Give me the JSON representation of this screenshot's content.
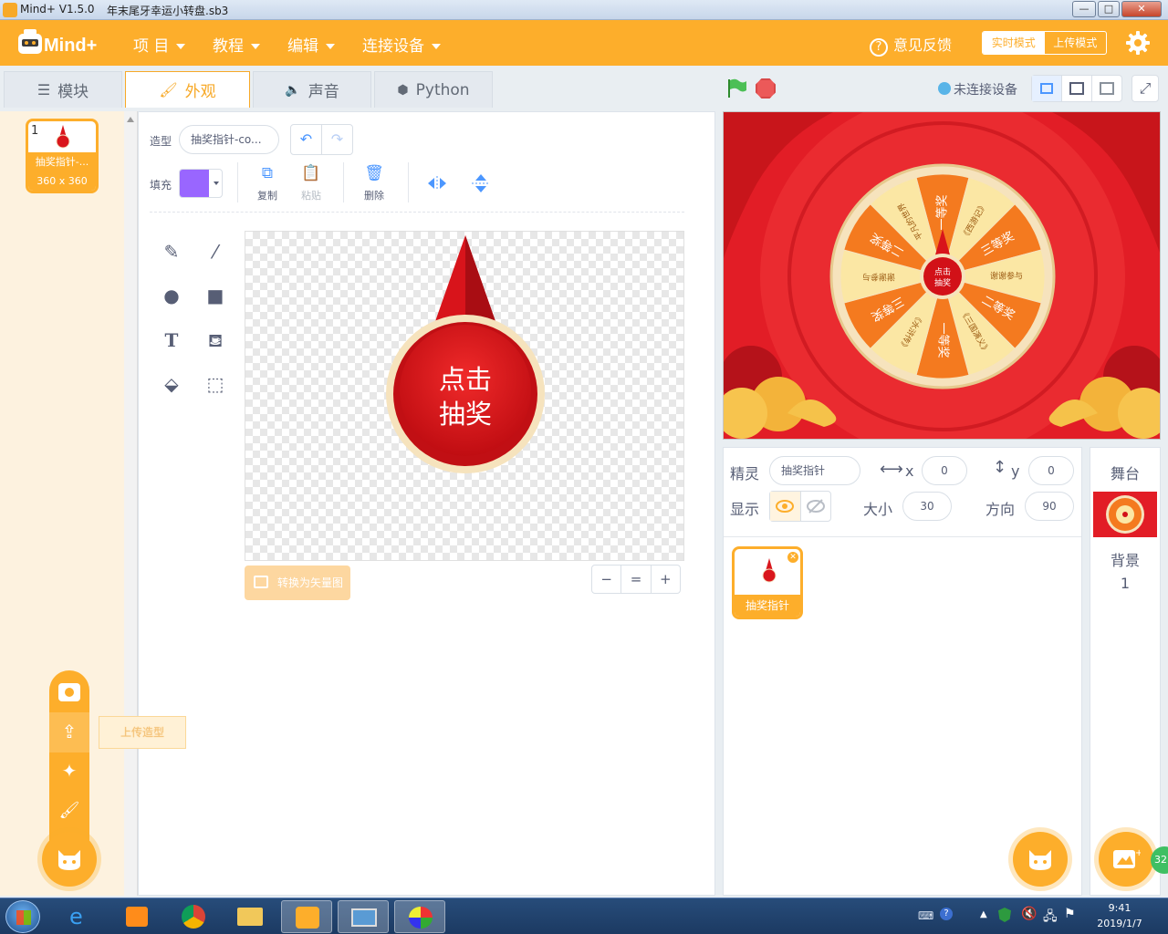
{
  "window": {
    "app_title": "Mind+ V1.5.0",
    "file_name": "年末尾牙幸运小转盘.sb3",
    "min": "—",
    "max": "□",
    "close": "✕"
  },
  "menubar": {
    "brand": "Mind+",
    "items": [
      "项 目",
      "教程",
      "编辑",
      "连接设备"
    ],
    "feedback": "意见反馈",
    "mode_realtime": "实时模式",
    "mode_upload": "上传模式"
  },
  "tabs": [
    {
      "label": "模块",
      "icon": "blocks-icon"
    },
    {
      "label": "外观",
      "icon": "brush-icon"
    },
    {
      "label": "声音",
      "icon": "speaker-icon"
    },
    {
      "label": "Python",
      "icon": "python-icon"
    }
  ],
  "costume_list": {
    "items": [
      {
        "index": "1",
        "name": "抽奖指针-...",
        "size": "360 x 360"
      }
    ]
  },
  "editor": {
    "costume_label": "造型",
    "costume_name": "抽奖指针-co...",
    "fill_label": "填充",
    "fill_color": "#9966ff",
    "copy": "复制",
    "paste": "粘贴",
    "delete": "删除",
    "pointer_text_line1": "点击",
    "pointer_text_line2": "抽奖",
    "convert_vector": "转换为矢量图",
    "zoom_out": "−",
    "zoom_reset": "=",
    "zoom_in": "+"
  },
  "upload_tooltip": "上传造型",
  "stage_header": {
    "device_status": "未连接设备"
  },
  "stage": {
    "center_line1": "点击",
    "center_line2": "抽奖",
    "segments": [
      "一等奖",
      "《西游记》",
      "三等奖",
      "谢谢参与",
      "二等奖",
      "《三国演义》",
      "一等奖",
      "《水浒传》",
      "三等奖",
      "谢谢参与",
      "二等奖",
      "平凡的世界"
    ]
  },
  "sprite_info": {
    "sprite_label": "精灵",
    "sprite_name": "抽奖指针",
    "x_label": "x",
    "x_value": "0",
    "y_label": "y",
    "y_value": "0",
    "show_label": "显示",
    "size_label": "大小",
    "size_value": "30",
    "direction_label": "方向",
    "direction_value": "90"
  },
  "sprites": [
    {
      "name": "抽奖指针"
    }
  ],
  "stage_panel": {
    "title": "舞台",
    "backdrop_label": "背景",
    "backdrop_count": "1"
  },
  "taskbar": {
    "time": "9:41",
    "date": "2019/1/7",
    "badge": "32"
  },
  "colors": {
    "accent": "#fdae2b",
    "stage_red": "#e8202a",
    "pointer_red": "#d9161c"
  }
}
